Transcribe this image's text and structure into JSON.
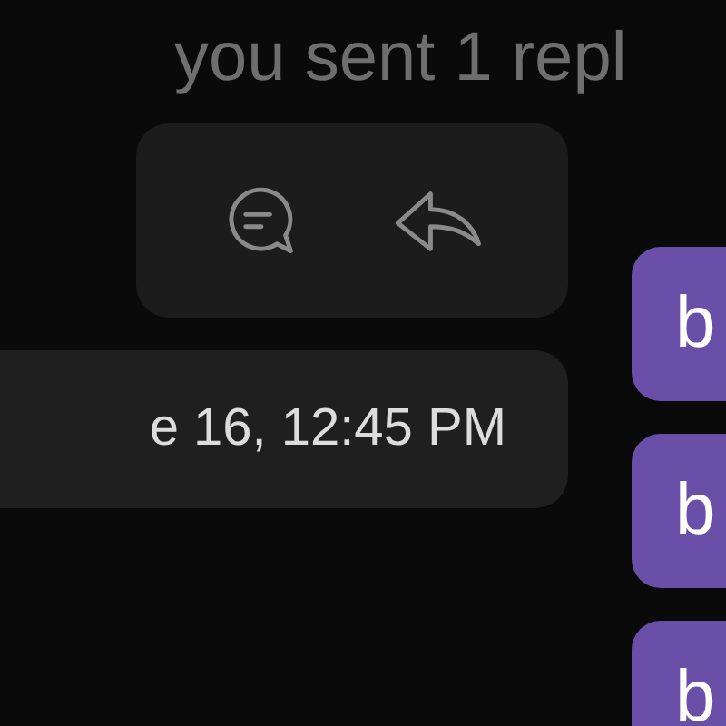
{
  "summary": "you sent 1 repl",
  "actions": [
    {
      "kind": "thread"
    },
    {
      "kind": "reply"
    }
  ],
  "timestamp": "e 16, 12:45 PM",
  "sent_messages": [
    {
      "text": "b"
    },
    {
      "text": "b"
    },
    {
      "text": "b"
    }
  ]
}
